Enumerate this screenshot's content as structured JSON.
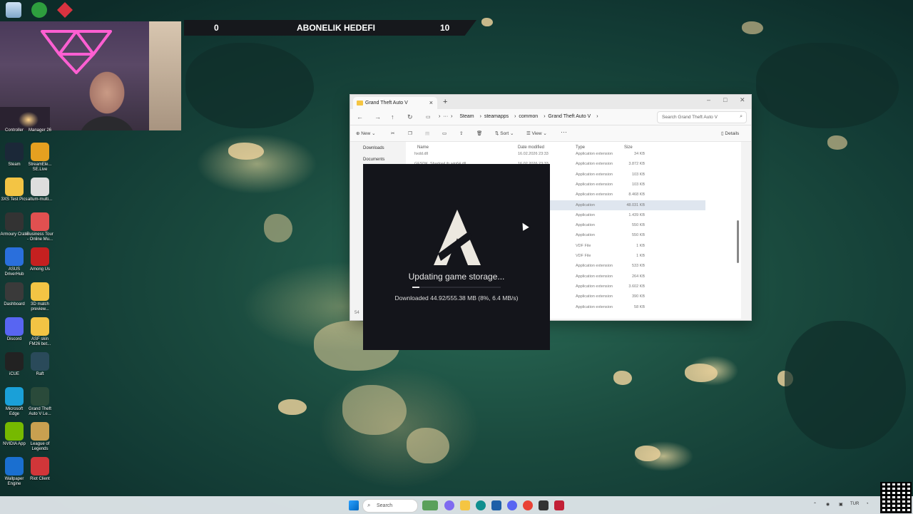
{
  "stream_overlay": {
    "goal_label": "ABONELIK HEDEFI",
    "goal_current": "0",
    "goal_target": "10"
  },
  "desktop_icons": [
    {
      "label": "Controller",
      "icon": "controller-icon"
    },
    {
      "label": "Manager 26",
      "icon": "manager-icon"
    },
    {
      "label": "Steam",
      "icon": "steam-icon"
    },
    {
      "label": "StreamEle... SE.Live",
      "icon": "streamelements-icon"
    },
    {
      "label": "3XS Test Pics",
      "icon": "folder-icon"
    },
    {
      "label": "altum-multi...",
      "icon": "settings-icon"
    },
    {
      "label": "Armoury Crate",
      "icon": "armoury-crate-icon"
    },
    {
      "label": "Business Tour - Online Mu...",
      "icon": "business-tour-icon"
    },
    {
      "label": "ASUS DriverHub",
      "icon": "asus-icon"
    },
    {
      "label": "Among Us",
      "icon": "among-us-icon"
    },
    {
      "label": "Dashboard",
      "icon": "dashboard-icon"
    },
    {
      "label": "3D match preview...",
      "icon": "folder-icon"
    },
    {
      "label": "Discord",
      "icon": "discord-icon"
    },
    {
      "label": "ASF skin FM26 bet...",
      "icon": "folder-icon"
    },
    {
      "label": "iCUE",
      "icon": "icue-icon"
    },
    {
      "label": "Raft",
      "icon": "raft-icon"
    },
    {
      "label": "Microsoft Edge",
      "icon": "edge-icon"
    },
    {
      "label": "Grand Theft Auto V Le...",
      "icon": "gta-icon"
    },
    {
      "label": "NVIDIA App",
      "icon": "nvidia-icon"
    },
    {
      "label": "League of Legends",
      "icon": "lol-icon"
    },
    {
      "label": "Wallpaper Engine",
      "icon": "wallpaper-engine-icon"
    },
    {
      "label": "Riot Client",
      "icon": "riot-icon"
    }
  ],
  "explorer": {
    "tab_title": "Grand Theft Auto V",
    "breadcrumbs": [
      "Steam",
      "steamapps",
      "common",
      "Grand Theft Auto V"
    ],
    "search_placeholder": "Search Grand Theft Auto V",
    "toolbar": {
      "new": "New",
      "sort": "Sort",
      "view": "View",
      "details": "Details"
    },
    "sidebar": [
      "Downloads",
      "Documents"
    ],
    "columns": {
      "name": "Name",
      "date": "Date modified",
      "type": "Type",
      "size": "Size"
    },
    "rows": [
      {
        "name": "hxdd.dll",
        "date": "16.02.2026 23:33",
        "type": "Application extension",
        "size": "34 KB"
      },
      {
        "name": "GFSDK_ShadowLib.win64.dll",
        "date": "16.02.2026 23:33",
        "type": "Application extension",
        "size": "3.872 KB"
      },
      {
        "name": "",
        "date": "",
        "type": "Application extension",
        "size": "103 KB"
      },
      {
        "name": "",
        "date": "",
        "type": "Application extension",
        "size": "103 KB"
      },
      {
        "name": "",
        "date": "",
        "type": "Application extension",
        "size": "8.468 KB"
      },
      {
        "name": "",
        "date": "",
        "type": "Application",
        "size": "48.031 KB"
      },
      {
        "name": "",
        "date": "",
        "type": "Application",
        "size": "1.439 KB"
      },
      {
        "name": "",
        "date": "",
        "type": "Application",
        "size": "550 KB"
      },
      {
        "name": "",
        "date": "",
        "type": "Application",
        "size": "550 KB"
      },
      {
        "name": "",
        "date": "",
        "type": "VDF File",
        "size": "1 KB"
      },
      {
        "name": "",
        "date": "",
        "type": "VDF File",
        "size": "1 KB"
      },
      {
        "name": "",
        "date": "",
        "type": "Application extension",
        "size": "533 KB"
      },
      {
        "name": "",
        "date": "",
        "type": "Application extension",
        "size": "264 KB"
      },
      {
        "name": "",
        "date": "",
        "type": "Application extension",
        "size": "3.602 KB"
      },
      {
        "name": "",
        "date": "",
        "type": "Application extension",
        "size": "390 KB"
      },
      {
        "name": "",
        "date": "",
        "type": "Application extension",
        "size": "58 KB"
      }
    ],
    "selected_row": 5,
    "item_count": "54"
  },
  "launcher": {
    "status": "Updating game storage...",
    "download_text": "Downloaded 44.92/555.38 MB (8%, 6.4 MB/s)",
    "progress": 0.08
  },
  "taskbar": {
    "search_label": "Search",
    "language": "TUR"
  }
}
